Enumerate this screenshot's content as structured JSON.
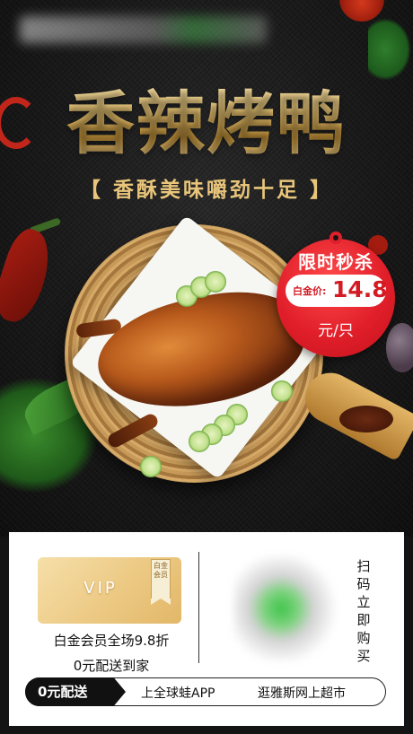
{
  "header": {
    "title": "香辣烤鸭",
    "subtitle": "【 香酥美味嚼劲十足 】"
  },
  "badge": {
    "headline": "限时秒杀",
    "price_label": "白金价:",
    "price": "14.8",
    "unit": "元/只"
  },
  "vip_card": {
    "label": "VIP",
    "ribbon": "白金会员"
  },
  "info": {
    "member_discount": "白金会员全场9.8折",
    "free_delivery": "0元配送到家",
    "scan_cta": "扫码立即购买"
  },
  "promo_bar": {
    "tag": "0元配送",
    "text_left": "上全球蛙APP",
    "text_right": "逛雅斯网上超市"
  },
  "colors": {
    "gold": "#e6c477",
    "badge_red": "#e11f2a",
    "background": "#141414"
  }
}
